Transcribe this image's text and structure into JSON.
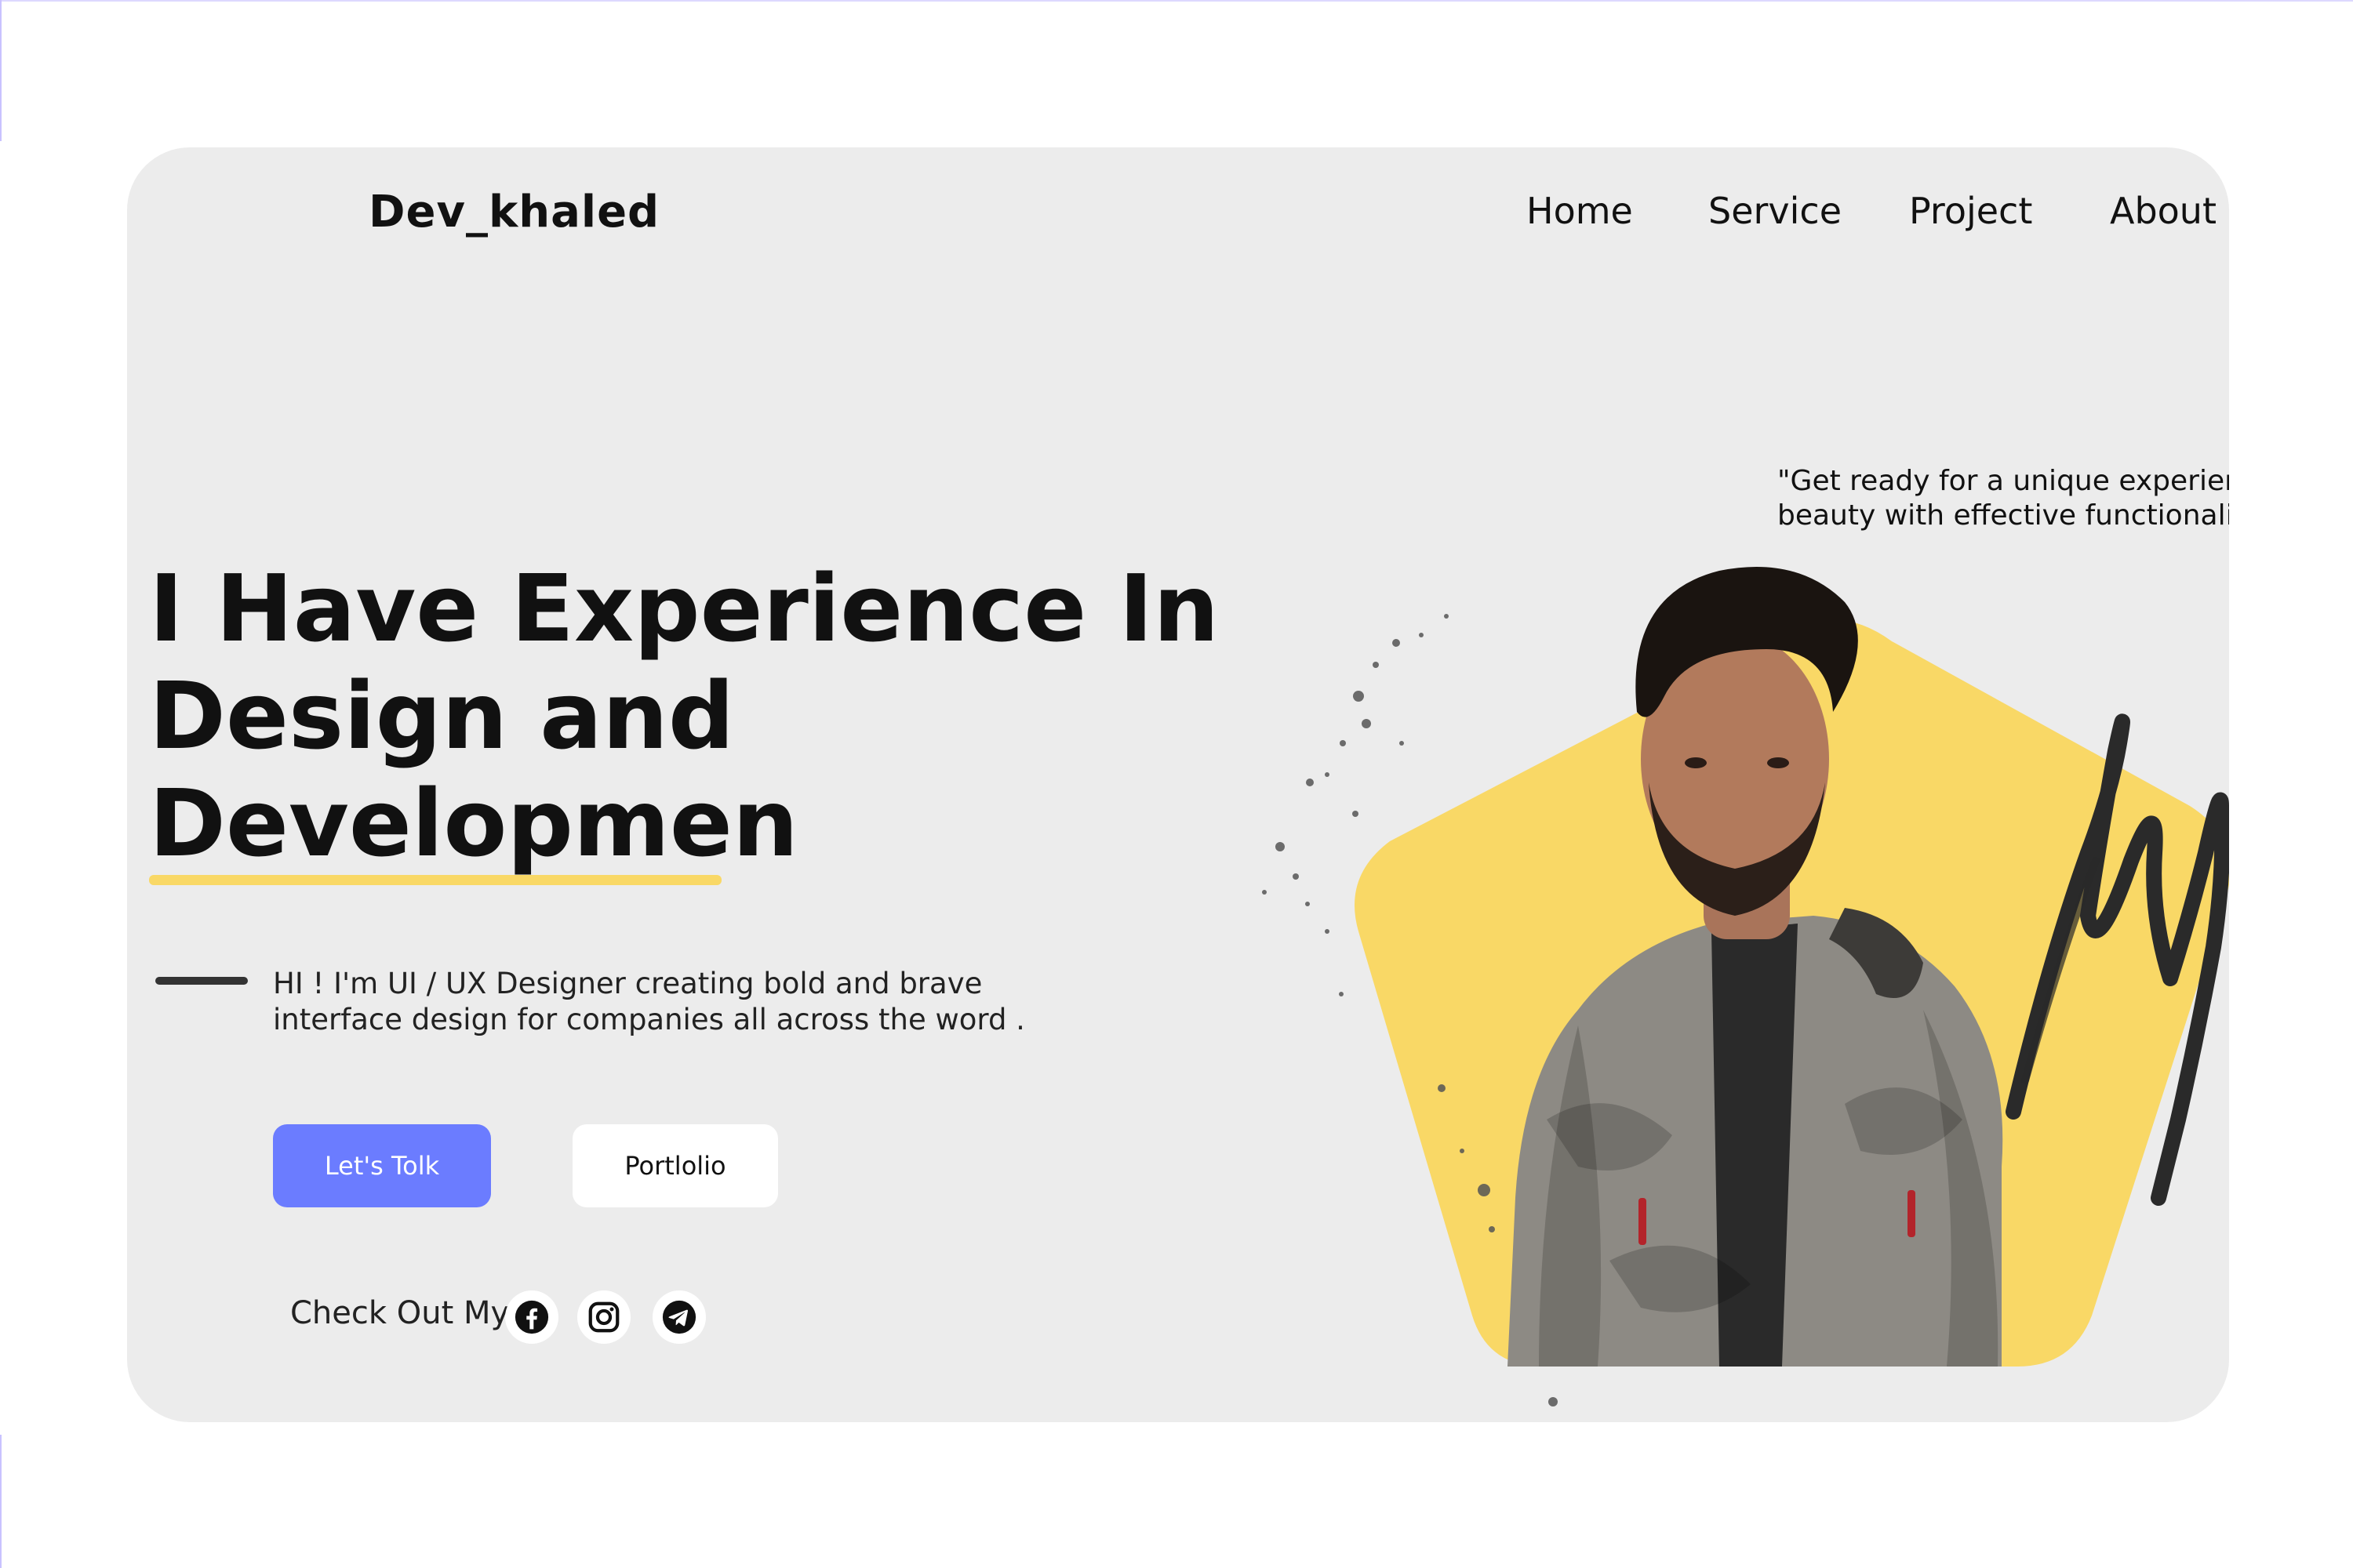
{
  "brand": {
    "name": "Dev_khaled"
  },
  "nav": {
    "items": [
      {
        "label": "Home"
      },
      {
        "label": "Service"
      },
      {
        "label": "Project"
      },
      {
        "label": "About"
      }
    ]
  },
  "hero": {
    "headline_lines": [
      "I Have Experience In",
      "Design and",
      "Developmen"
    ],
    "intro": "HI ! I'm UI / UX Designer creating bold and brave interface design for companies all across the word .",
    "primary_button": "Let's Tolk",
    "secondary_button": "Portlolio",
    "quote": "\"Get ready for a unique experien beauty with effective functionalit"
  },
  "quote_lines": [
    "\"Get ready for a unique experien",
    "beauty with effective functionalit"
  ],
  "social": {
    "label": "Check Out My",
    "icons": [
      "facebook-icon",
      "instagram-icon",
      "telegram-icon"
    ]
  },
  "colors": {
    "card": "#ececec",
    "accent_yellow": "#f9d866",
    "primary_button": "#6b7cff",
    "text": "#111111"
  }
}
